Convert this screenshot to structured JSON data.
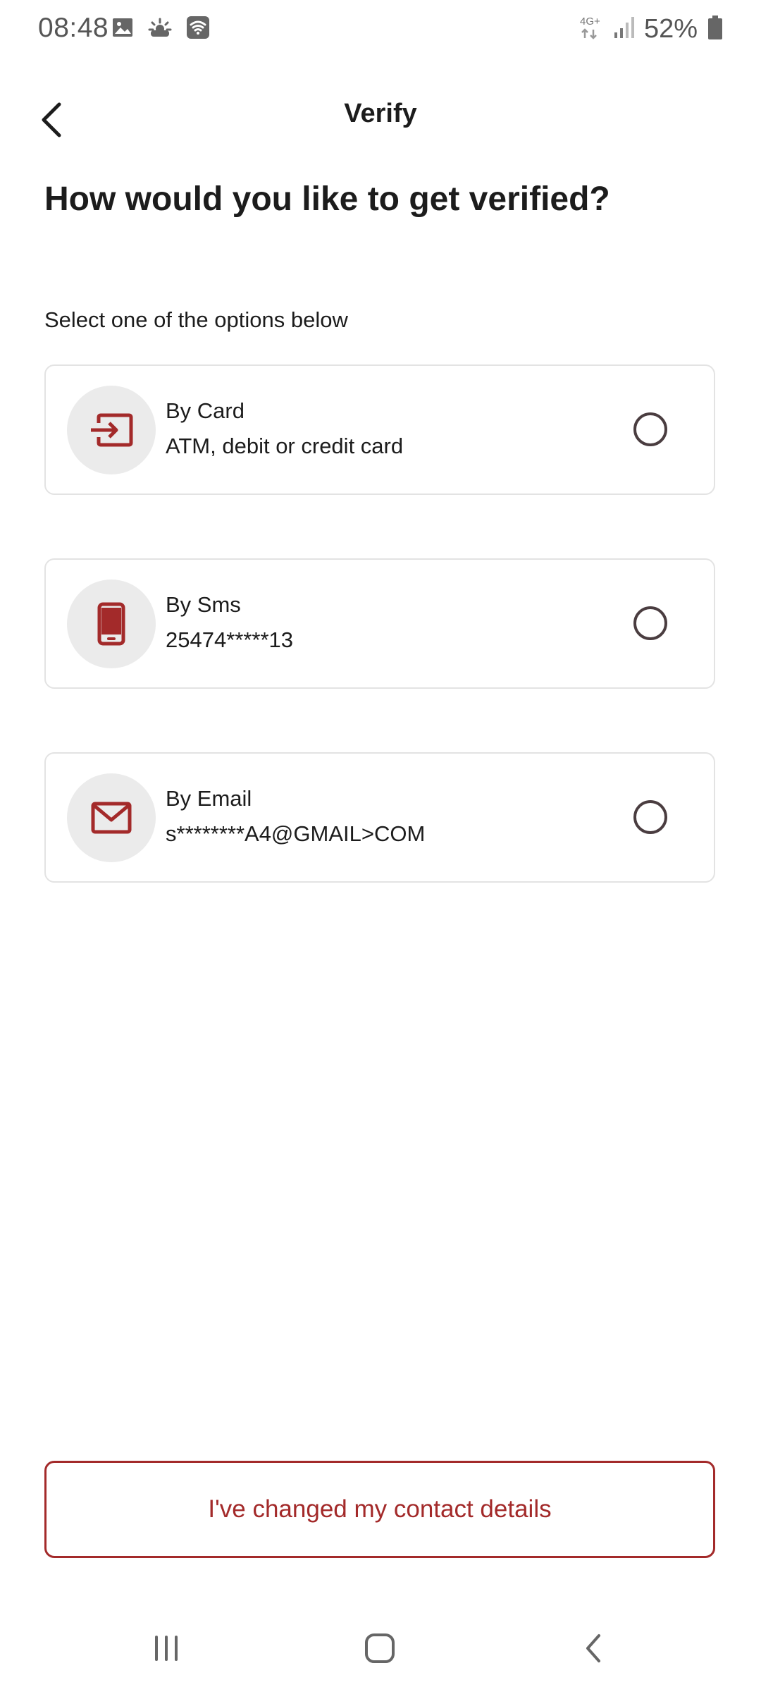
{
  "status_bar": {
    "time": "08:48",
    "battery_text": "52%",
    "network_type": "4G+",
    "icons": [
      "image-icon",
      "weather-icon",
      "wifi-calling-icon",
      "network-4g-icon",
      "signal-icon",
      "battery-icon"
    ]
  },
  "app_bar": {
    "title": "Verify",
    "back_icon": "back-arrow-icon"
  },
  "heading": "How would you like to get verified?",
  "subheading": "Select one of the options below",
  "options": [
    {
      "title": "By Card",
      "detail": "ATM, debit or credit card",
      "icon": "card-login-icon",
      "selected": false
    },
    {
      "title": "By Sms",
      "detail": "25474*****13",
      "icon": "phone-icon",
      "selected": false
    },
    {
      "title": "By Email",
      "detail": "s********A4@GMAIL>COM",
      "icon": "email-icon",
      "selected": false
    }
  ],
  "contact_button_label": "I've changed my contact details",
  "nav_bar": {
    "icons": [
      "recent-apps-icon",
      "home-icon",
      "back-icon"
    ]
  },
  "colors": {
    "accent": "#a32a2a",
    "icon_circle_bg": "#ebebeb",
    "card_border": "#e3e3e3",
    "radio_border": "#4a3d40"
  }
}
